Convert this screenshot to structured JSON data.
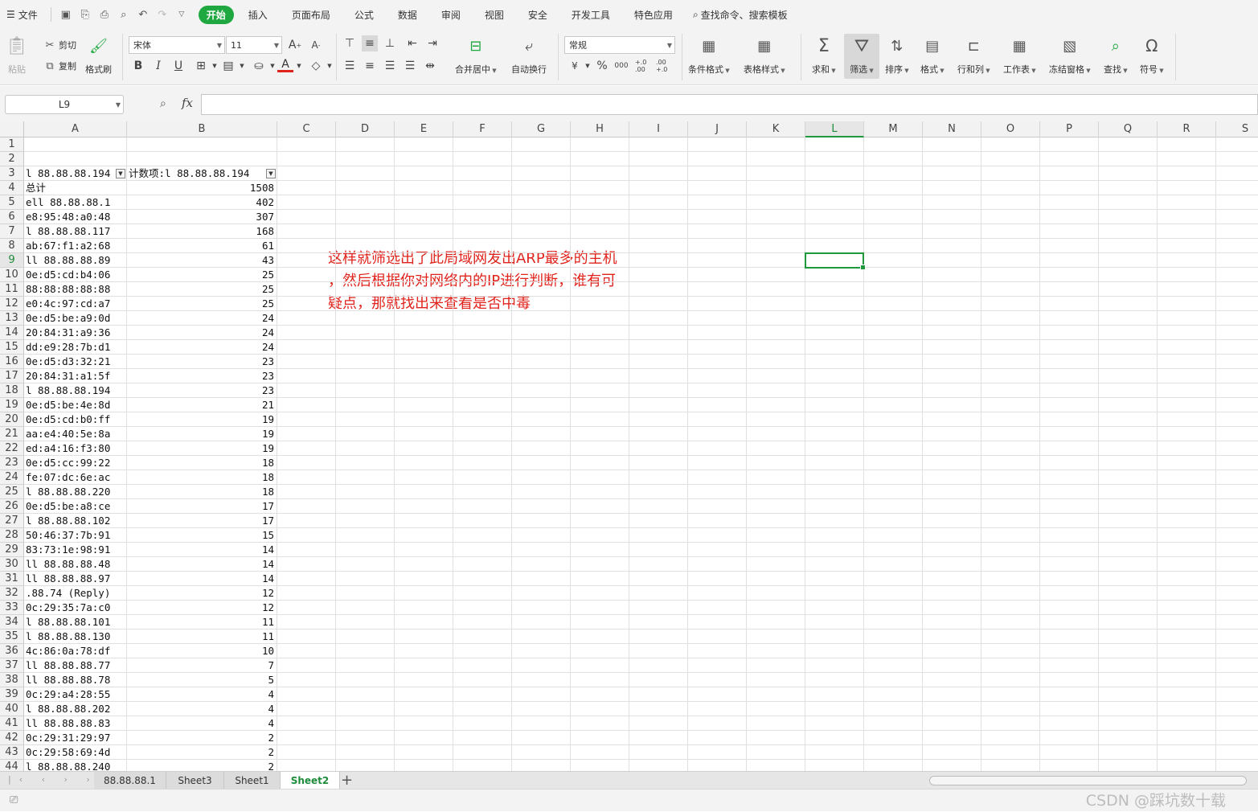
{
  "menubar": {
    "file_label": "文件",
    "tabs": [
      "开始",
      "插入",
      "页面布局",
      "公式",
      "数据",
      "审阅",
      "视图",
      "安全",
      "开发工具",
      "特色应用"
    ],
    "active_tab": "开始",
    "search_label": "查找命令、搜索模板"
  },
  "ribbon": {
    "paste": "粘贴",
    "cut": "剪切",
    "copy": "复制",
    "format_painter": "格式刷",
    "font_name": "宋体",
    "font_size": "11",
    "merge_center": "合并居中",
    "wrap_text": "自动换行",
    "number_format": "常规",
    "conditional_format": "条件格式",
    "table_style": "表格样式",
    "sum": "求和",
    "filter": "筛选",
    "sort": "排序",
    "format": "格式",
    "row_col": "行和列",
    "worksheet": "工作表",
    "freeze": "冻结窗格",
    "find": "查找",
    "symbol": "符号",
    "bold": "B",
    "italic": "I",
    "underline": "U",
    "font_grow": "A",
    "font_shrink": "A",
    "currency": "¥",
    "percent": "%",
    "thousands": "000",
    "inc_decimal": "+.0 .00",
    "dec_decimal": ".00 +.0"
  },
  "formula": {
    "name_box": "L9",
    "fx": "fx",
    "value": ""
  },
  "columns": [
    "A",
    "B",
    "C",
    "D",
    "E",
    "F",
    "G",
    "H",
    "I",
    "J",
    "K",
    "L",
    "M",
    "N",
    "O",
    "P",
    "Q",
    "R",
    "S"
  ],
  "selected_column": "L",
  "selected_row": 9,
  "row_numbers": [
    1,
    2,
    3,
    4,
    5,
    6,
    7,
    8,
    9,
    10,
    11,
    12,
    13,
    14,
    15,
    16,
    17,
    18,
    19,
    20,
    21,
    22,
    23,
    24,
    25,
    26,
    27,
    28,
    29,
    30,
    31,
    32,
    33,
    34,
    35,
    36,
    37,
    38,
    39,
    40,
    41,
    42,
    43,
    44
  ],
  "pivot": {
    "header_a": "l 88.88.88.194",
    "header_b": "计数项:l 88.88.88.194",
    "rows": [
      {
        "a": "总计",
        "b": "1508"
      },
      {
        "a": "ell 88.88.88.1",
        "b": "402"
      },
      {
        "a": "e8:95:48:a0:48",
        "b": "307"
      },
      {
        "a": "l 88.88.88.117",
        "b": "168"
      },
      {
        "a": "ab:67:f1:a2:68",
        "b": "61"
      },
      {
        "a": "ll 88.88.88.89",
        "b": "43"
      },
      {
        "a": "0e:d5:cd:b4:06",
        "b": "25"
      },
      {
        "a": "88:88:88:88:88",
        "b": "25"
      },
      {
        "a": "e0:4c:97:cd:a7",
        "b": "25"
      },
      {
        "a": "0e:d5:be:a9:0d",
        "b": "24"
      },
      {
        "a": "20:84:31:a9:36",
        "b": "24"
      },
      {
        "a": "dd:e9:28:7b:d1",
        "b": "24"
      },
      {
        "a": "0e:d5:d3:32:21",
        "b": "23"
      },
      {
        "a": "20:84:31:a1:5f",
        "b": "23"
      },
      {
        "a": "l 88.88.88.194",
        "b": "23"
      },
      {
        "a": "0e:d5:be:4e:8d",
        "b": "21"
      },
      {
        "a": "0e:d5:cd:b0:ff",
        "b": "19"
      },
      {
        "a": "aa:e4:40:5e:8a",
        "b": "19"
      },
      {
        "a": "ed:a4:16:f3:80",
        "b": "19"
      },
      {
        "a": "0e:d5:cc:99:22",
        "b": "18"
      },
      {
        "a": "fe:07:dc:6e:ac",
        "b": "18"
      },
      {
        "a": "l 88.88.88.220",
        "b": "18"
      },
      {
        "a": "0e:d5:be:a8:ce",
        "b": "17"
      },
      {
        "a": "l 88.88.88.102",
        "b": "17"
      },
      {
        "a": "50:46:37:7b:91",
        "b": "15"
      },
      {
        "a": "83:73:1e:98:91",
        "b": "14"
      },
      {
        "a": "ll 88.88.88.48",
        "b": "14"
      },
      {
        "a": "ll 88.88.88.97",
        "b": "14"
      },
      {
        "a": ".88.74 (Reply)",
        "b": "12"
      },
      {
        "a": "0c:29:35:7a:c0",
        "b": "12"
      },
      {
        "a": "l 88.88.88.101",
        "b": "11"
      },
      {
        "a": "l 88.88.88.130",
        "b": "11"
      },
      {
        "a": "4c:86:0a:78:df",
        "b": "10"
      },
      {
        "a": "ll 88.88.88.77",
        "b": "7"
      },
      {
        "a": "ll 88.88.88.78",
        "b": "5"
      },
      {
        "a": "0c:29:a4:28:55",
        "b": "4"
      },
      {
        "a": "l 88.88.88.202",
        "b": "4"
      },
      {
        "a": "ll 88.88.88.83",
        "b": "4"
      },
      {
        "a": "0c:29:31:29:97",
        "b": "2"
      },
      {
        "a": "0c:29:58:69:4d",
        "b": "2"
      },
      {
        "a": "l 88.88.88.240",
        "b": "2"
      }
    ]
  },
  "annotation": {
    "line1": "这样就筛选出了此局域网发出ARP最多的主机",
    "line2": "，然后根据你对网络内的IP进行判断，谁有可",
    "line3": "疑点，那就找出来查看是否中毒"
  },
  "sheets": [
    {
      "name": "88.88.88.1",
      "active": false
    },
    {
      "name": "Sheet3",
      "active": false
    },
    {
      "name": "Sheet1",
      "active": false
    },
    {
      "name": "Sheet2",
      "active": true
    }
  ],
  "add_sheet": "+",
  "watermark": "CSDN @踩坑数十载",
  "colors": {
    "accent": "#1fa83f",
    "annotation": "#e0231c",
    "selection": "#1e9a3c"
  }
}
